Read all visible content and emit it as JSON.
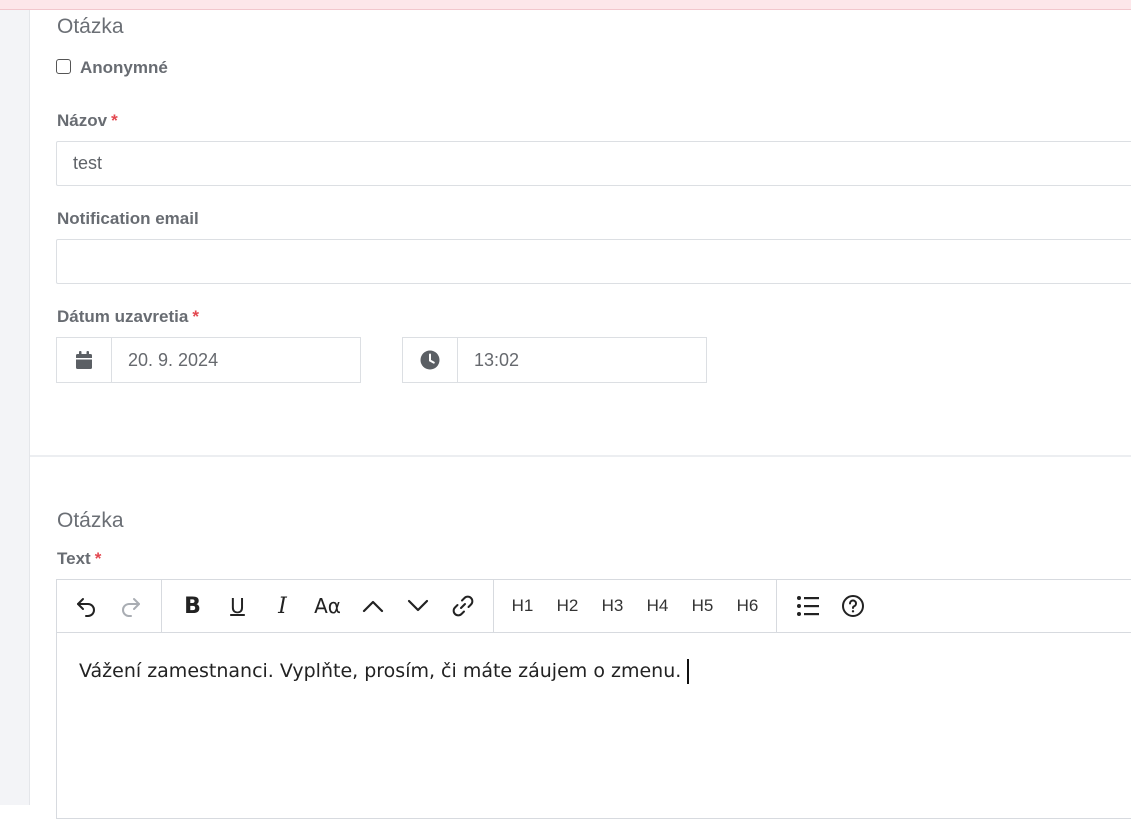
{
  "question_section": {
    "title": "Otázka",
    "anonymous_label": "Anonymné",
    "anonymous_checked": false,
    "name_label": "Názov",
    "name_value": "test",
    "email_label": "Notification email",
    "email_value": "",
    "close_date_label": "Dátum uzavretia",
    "date_value": "20. 9. 2024",
    "time_value": "13:02",
    "required_mark": "*"
  },
  "text_section": {
    "title": "Otázka",
    "text_label": "Text",
    "required_mark": "*",
    "toolbar": {
      "history": [
        {
          "name": "undo-icon"
        },
        {
          "name": "redo-icon",
          "disabled": true
        }
      ],
      "formatting": [
        "bold-icon",
        "underline-icon",
        "italic-icon",
        "font-size-icon",
        "superscript-up-icon",
        "subscript-down-icon",
        "link-icon"
      ],
      "headings": [
        "H1",
        "H2",
        "H3",
        "H4",
        "H5",
        "H6"
      ],
      "lists": [
        "bullet-list-icon",
        "help-icon"
      ]
    },
    "content": "Vážení zamestnanci. Vyplňte, prosím, či máte záujem o zmenu."
  },
  "colors": {
    "required": "#e3474f",
    "top_band": "#fde7ea"
  }
}
